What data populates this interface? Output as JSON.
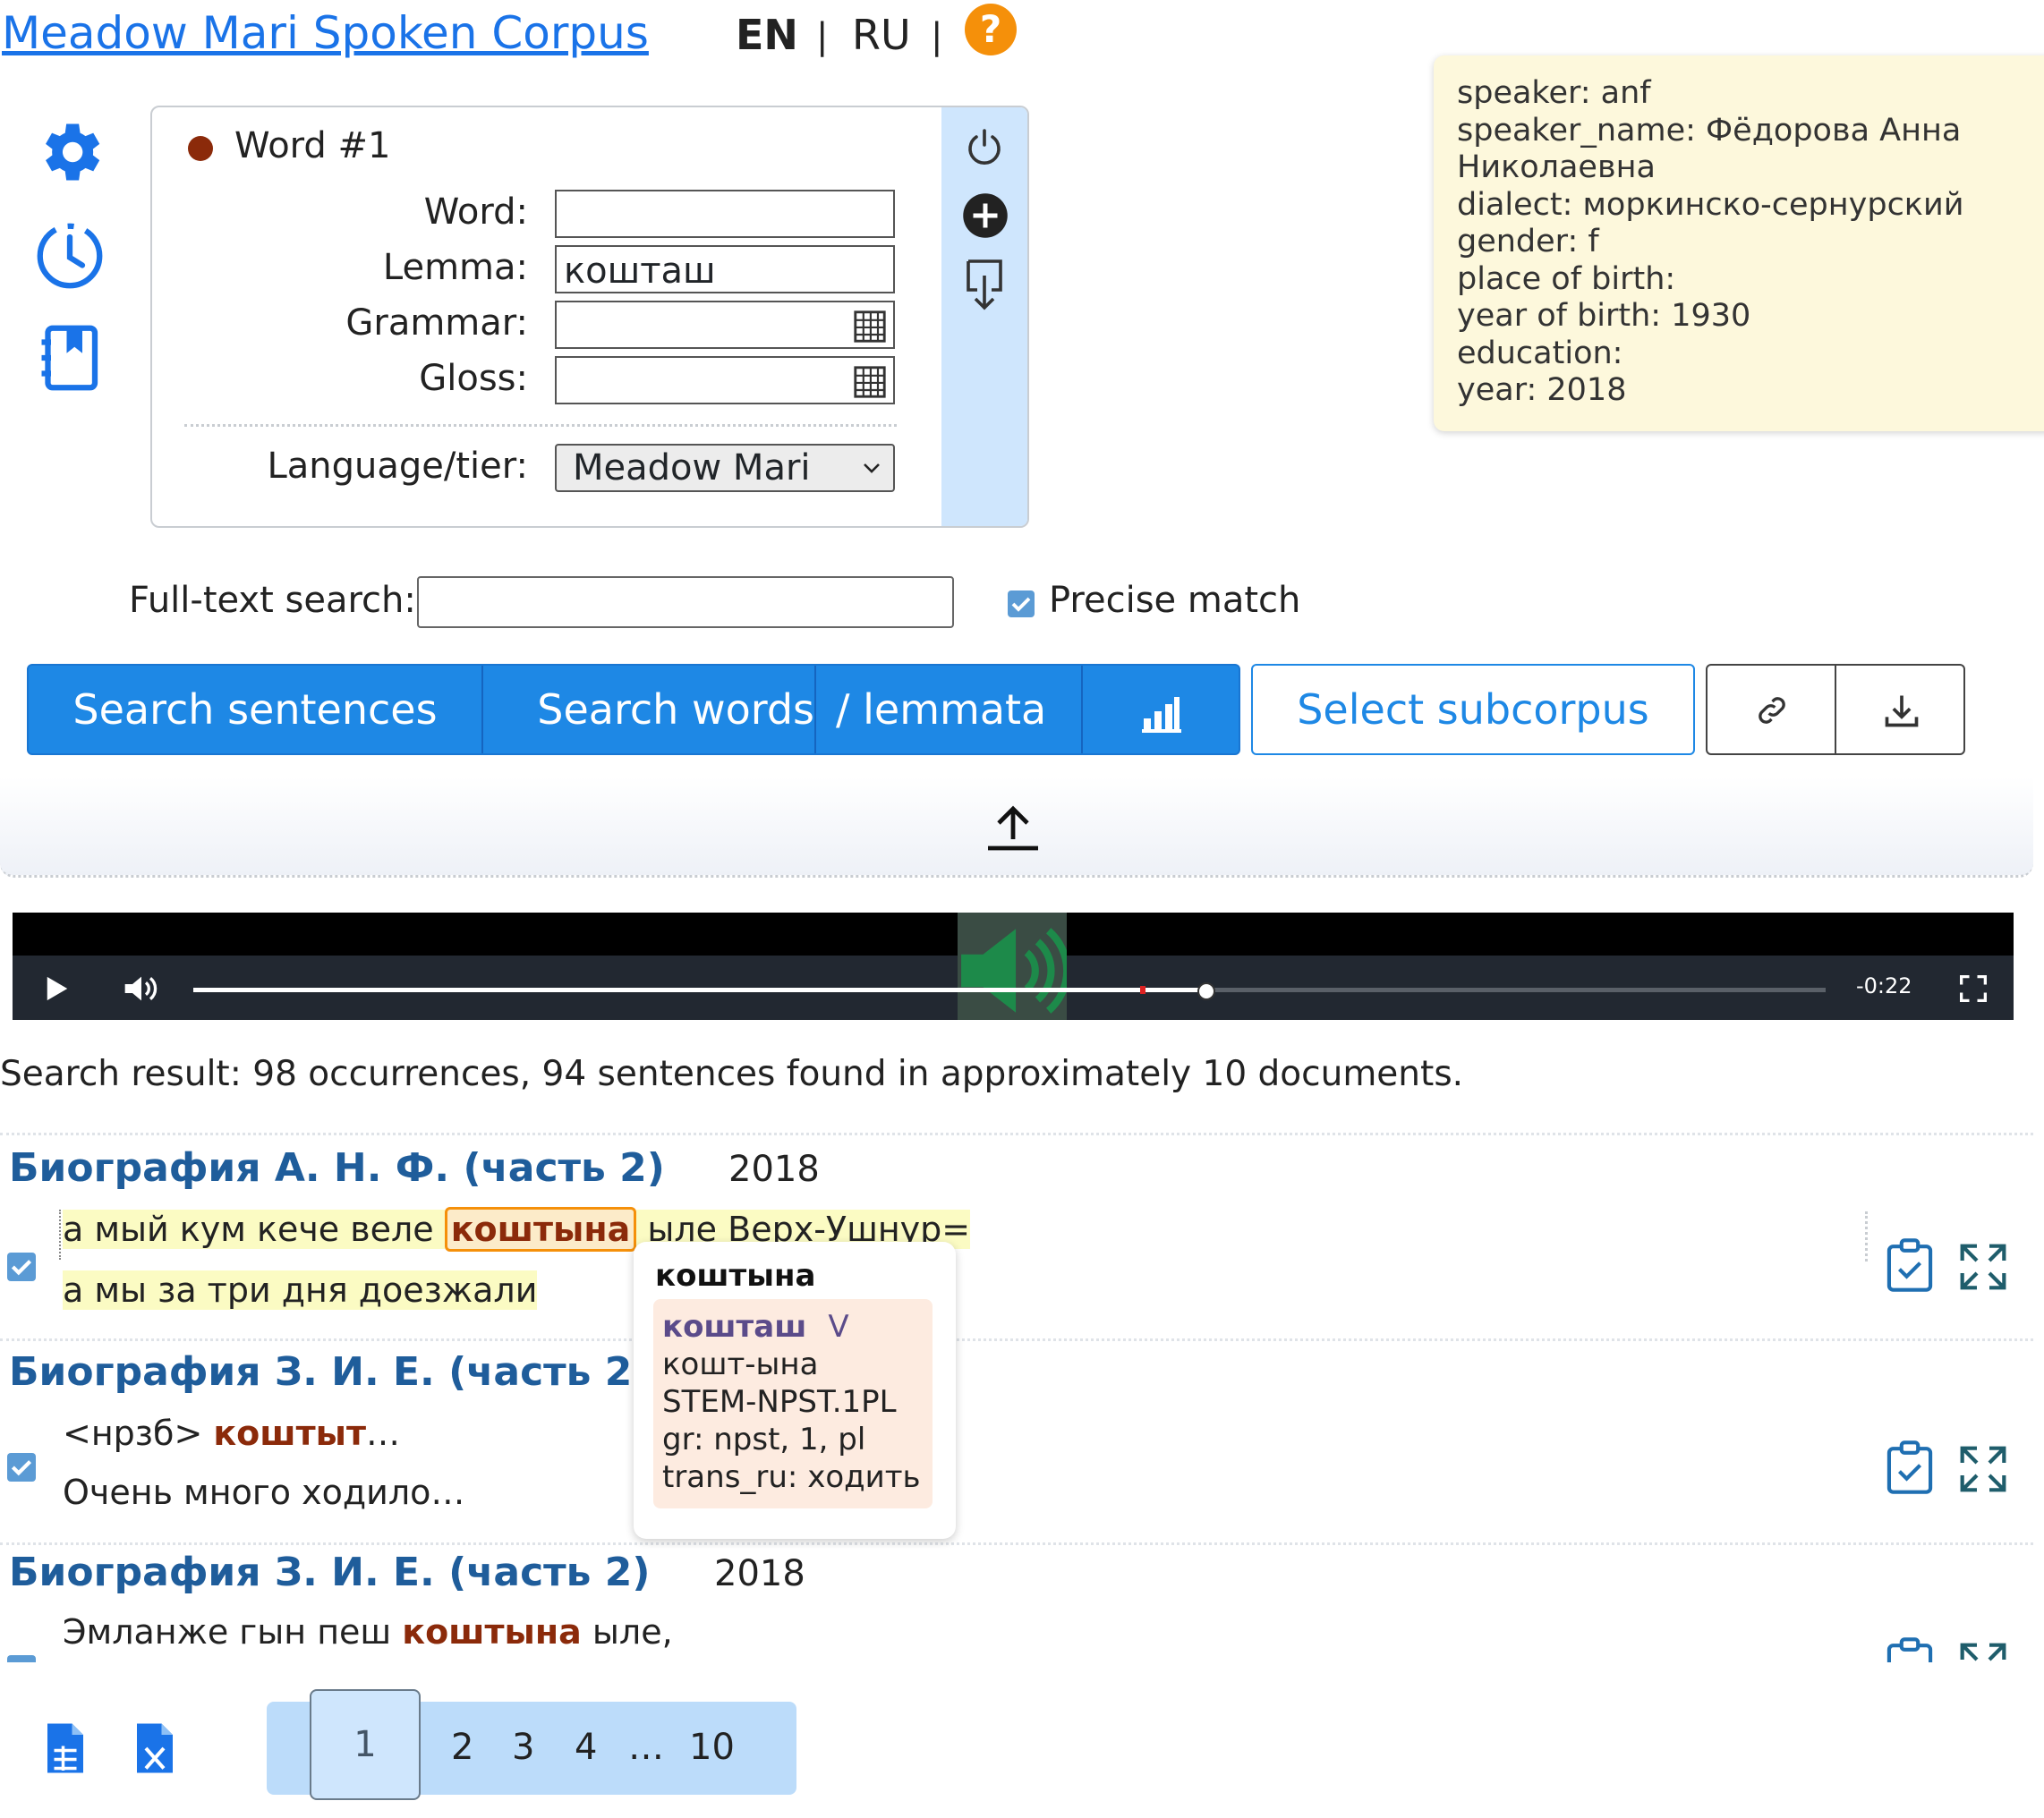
{
  "header": {
    "title": "Meadow Mari Spoken Corpus",
    "lang_en": "EN",
    "lang_sep": "|",
    "lang_ru": "RU",
    "help": "?"
  },
  "sidebar": {
    "icons": [
      "gear-icon",
      "history-icon",
      "notebook-icon"
    ]
  },
  "word_box": {
    "title": "Word #1",
    "word_label": "Word:",
    "word_value": "",
    "lemma_label": "Lemma:",
    "lemma_value": "кошташ",
    "grammar_label": "Grammar:",
    "grammar_value": "",
    "gloss_label": "Gloss:",
    "gloss_value": "",
    "language_label": "Language/tier:",
    "language_value": "Meadow Mari",
    "side_icons": [
      "power-icon",
      "add-word-icon",
      "negate-word-icon"
    ]
  },
  "speaker_info": [
    "speaker: anf",
    "speaker_name: Фёдорова Анна",
    "Николаевна",
    "dialect: моркинско-сернурский",
    "gender: f",
    "place of birth:",
    "year of birth: 1930",
    "education:",
    "year: 2018"
  ],
  "fulltext": {
    "label": "Full-text search:",
    "value": "",
    "precise_label": "Precise match",
    "precise_checked": true
  },
  "buttons": {
    "search_sentences": "Search sentences",
    "search_words": "Search words",
    "lemmata": "/ lemmata",
    "stats_icon": "bar-chart-icon",
    "select_subcorpus": "Select subcorpus",
    "link_icon": "link-icon",
    "download_icon": "download-icon"
  },
  "player": {
    "time": "-0:22",
    "progress": 0.62
  },
  "results": {
    "summary": "Search result: 98 occurrences, 94 sentences found in approximately 10 documents.",
    "items": [
      {
        "title": "Биография А. Н. Ф. (часть 2)",
        "year": "2018",
        "line1_before": "а мый кум кече веле ",
        "line1_kw": "коштына",
        "line1_after": " ыле Верх-Ушнур=",
        "line2": "а мы за три дня доезжали"
      },
      {
        "title": "Биография З. И. Е. (часть 2)",
        "year": "",
        "line1_before": "<нрзб> ",
        "line1_kw": "коштыт",
        "line1_after": "…",
        "line2": "Очень много ходило…"
      },
      {
        "title": "Биография З. И. Е. (часть 2)",
        "year": "2018",
        "line1_before": "Эмланже гын пеш ",
        "line1_kw": "коштына",
        "line1_after": " ыле,",
        "line2": ""
      }
    ]
  },
  "word_tooltip": {
    "word": "коштына",
    "lemma": "кошташ",
    "pos": "V",
    "morph": "кошт-ына",
    "gloss": "STEM-NPST.1PL",
    "gr": "gr: npst, 1, pl",
    "trans": "trans_ru: ходить"
  },
  "pagination": {
    "current": "1",
    "pages": [
      "2",
      "3",
      "4"
    ],
    "ellipsis": "…",
    "last": "10"
  },
  "colors": {
    "primary": "#1e88e5",
    "keyword": "#8b2a0a",
    "help": "#f5900a"
  }
}
